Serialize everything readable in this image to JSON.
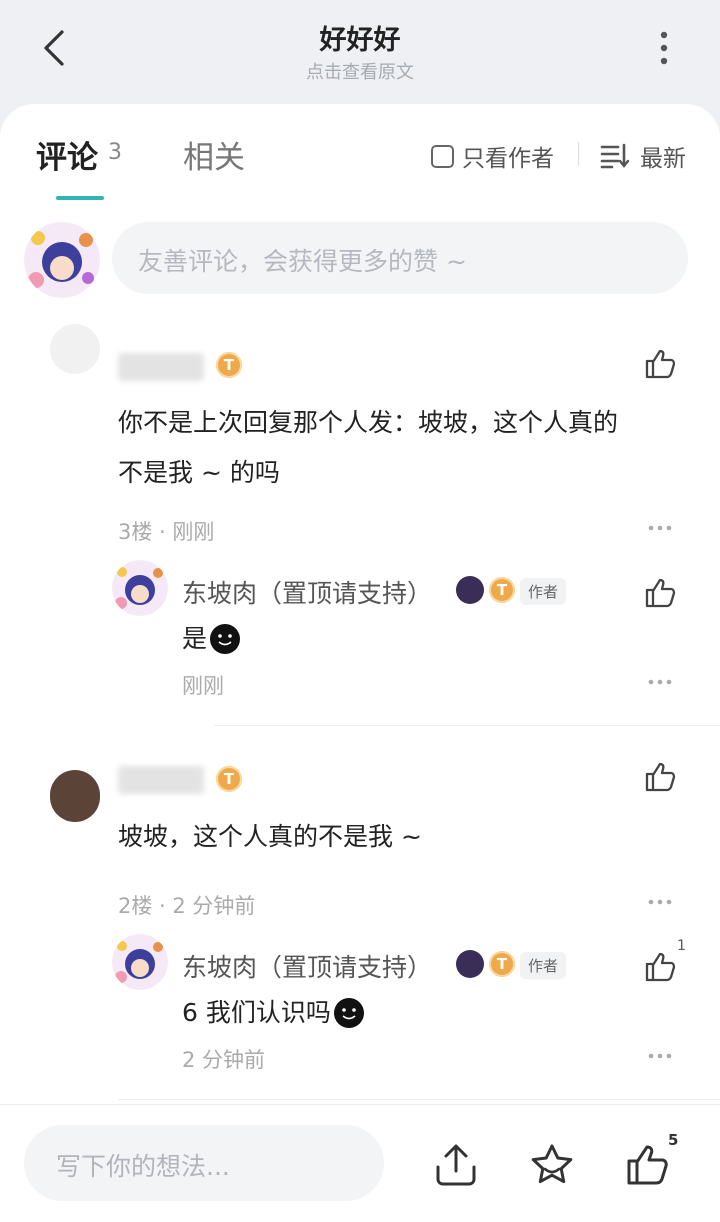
{
  "header": {
    "title": "好好好",
    "subtitle": "点击查看原文"
  },
  "tabs": {
    "comment_label": "评论",
    "comment_count": "3",
    "related_label": "相关",
    "author_only_label": "只看作者",
    "sort_label": "最新"
  },
  "input": {
    "placeholder": "友善评论，会获得更多的赞 ~"
  },
  "comments": [
    {
      "text": "你不是上次回复那个人发：坡坡，这个人真的不是我 ~ 的吗",
      "text_line1": "你不是上次回复那个人发：坡坡，这个人真的",
      "text_line2": "不是我 ~  的吗",
      "meta": "3楼 · 刚刚",
      "reply": {
        "author": "东坡肉（置顶请支持）",
        "author_tag": "作者",
        "text": "是",
        "time": "刚刚"
      }
    },
    {
      "text": "坡坡，这个人真的不是我 ~",
      "meta": "2楼 · 2 分钟前",
      "reply": {
        "author": "东坡肉（置顶请支持）",
        "author_tag": "作者",
        "text": "6 我们认识吗",
        "time": "2 分钟前",
        "like_count": "1"
      }
    }
  ],
  "bottom": {
    "placeholder": "写下你的想法...",
    "like_count": "5"
  },
  "badges": {
    "coin_letter": "T"
  },
  "colors": {
    "accent": "#2fb5b5",
    "coin": "#f0a94a",
    "background": "#eef0f3"
  },
  "icons": [
    "back-arrow-icon",
    "more-vertical-icon",
    "checkbox-icon",
    "sort-icon",
    "thumbs-up-icon",
    "more-horizontal-icon",
    "share-icon",
    "star-icon",
    "smiley-emoji-icon"
  ]
}
